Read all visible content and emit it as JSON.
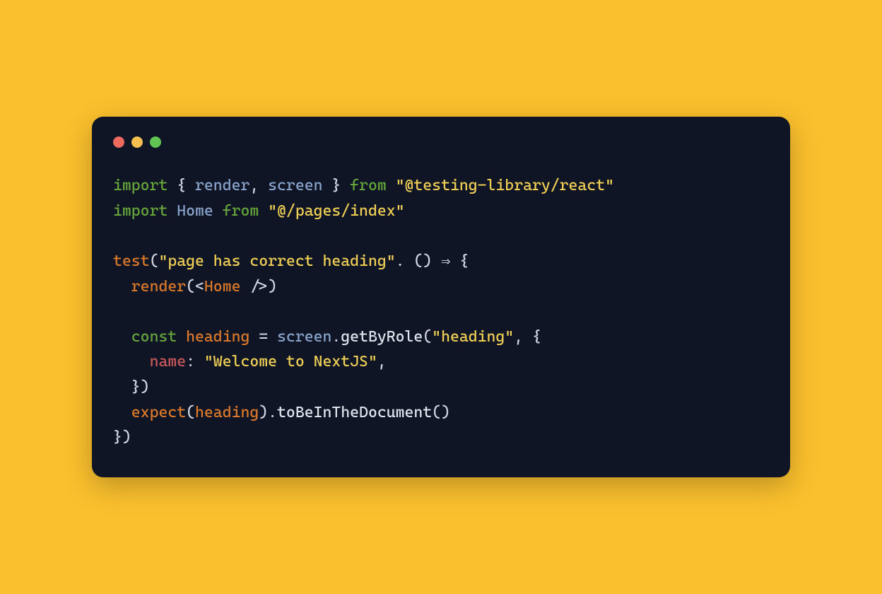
{
  "colors": {
    "background": "#fbc02d",
    "card": "#0f1525",
    "traffic_red": "#ed6a5e",
    "traffic_yellow": "#f4bf4f",
    "traffic_green": "#61c554"
  },
  "code": {
    "line1": {
      "t1": "import",
      "t2": " { ",
      "t3": "render",
      "t4": ", ",
      "t5": "screen",
      "t6": " } ",
      "t7": "from",
      "t8": " ",
      "t9": "\"@testing-library/react\""
    },
    "line2": {
      "t1": "import",
      "t2": " ",
      "t3": "Home",
      "t4": " ",
      "t5": "from",
      "t6": " ",
      "t7": "\"@/pages/index\""
    },
    "line3": "",
    "line4": {
      "t1": "test",
      "t2": "(",
      "t3": "\"page has correct heading\"",
      "t4": ". () ",
      "t5": "⇒",
      "t6": " {"
    },
    "line5": {
      "t1": "  ",
      "t2": "render",
      "t3": "(<",
      "t4": "Home",
      "t5": " />)"
    },
    "line6": "",
    "line7": {
      "t1": "  ",
      "t2": "const",
      "t3": " ",
      "t4": "heading",
      "t5": " = ",
      "t6": "screen",
      "t7": ".",
      "t8": "getByRole",
      "t9": "(",
      "t10": "\"heading\"",
      "t11": ", {"
    },
    "line8": {
      "t1": "    ",
      "t2": "name",
      "t3": ": ",
      "t4": "\"Welcome to NextJS\"",
      "t5": ","
    },
    "line9": {
      "t1": "  })"
    },
    "line10": {
      "t1": "  ",
      "t2": "expect",
      "t3": "(",
      "t4": "heading",
      "t5": ").",
      "t6": "toBeInTheDocument",
      "t7": "()"
    },
    "line11": {
      "t1": "})"
    }
  }
}
